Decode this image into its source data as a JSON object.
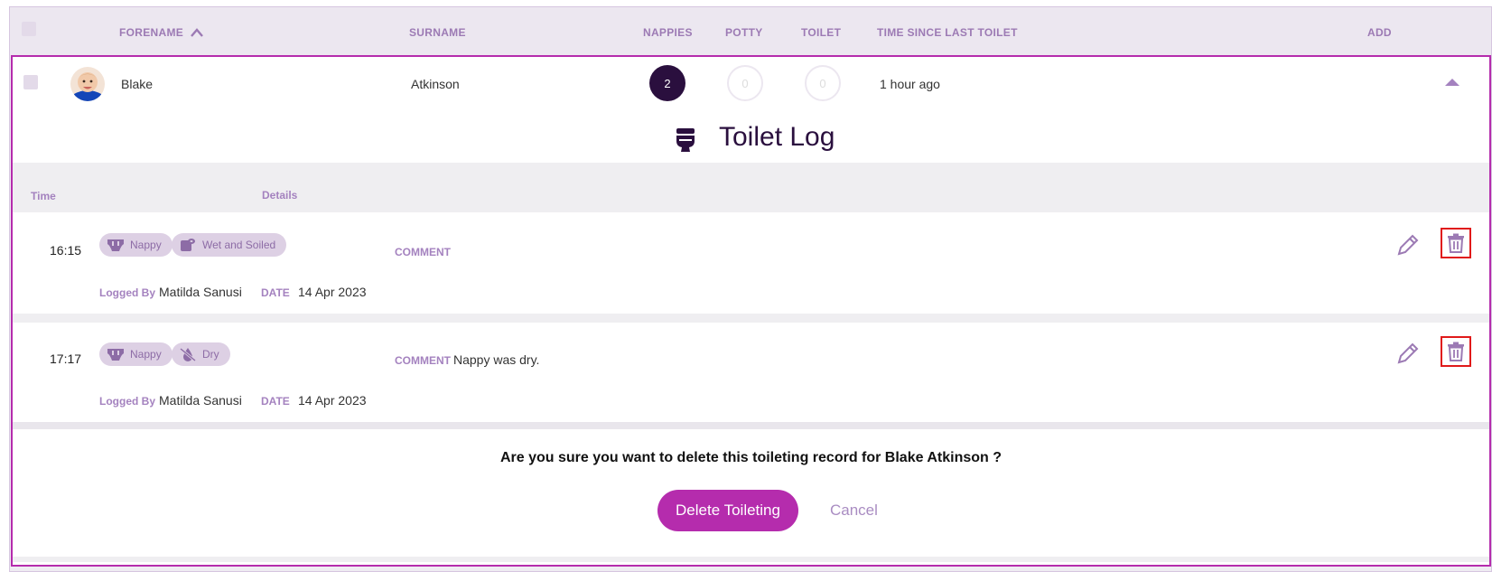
{
  "header": {
    "forename": "FORENAME",
    "surname": "SURNAME",
    "nappies": "NAPPIES",
    "potty": "POTTY",
    "toilet": "TOILET",
    "time_since": "TIME SINCE LAST TOILET",
    "add": "ADD"
  },
  "child": {
    "forename": "Blake",
    "surname": "Atkinson",
    "nappies": "2",
    "potty": "0",
    "toilet": "0",
    "time_since": "1 hour ago"
  },
  "log": {
    "title": "Toilet Log",
    "col_time": "Time",
    "col_details": "Details",
    "comment_label": "COMMENT",
    "logged_by_label": "Logged By",
    "date_label": "DATE",
    "entries": [
      {
        "time": "16:15",
        "tag1": "Nappy",
        "tag1_icon": "nappy-icon",
        "tag2": "Wet and Soiled",
        "tag2_icon": "toilet-roll-icon",
        "comment": "",
        "logged_by": "Matilda Sanusi",
        "date": "14 Apr 2023"
      },
      {
        "time": "17:17",
        "tag1": "Nappy",
        "tag1_icon": "nappy-icon",
        "tag2": "Dry",
        "tag2_icon": "no-water-icon",
        "comment": "Nappy was dry.",
        "logged_by": "Matilda Sanusi",
        "date": "14 Apr 2023"
      }
    ]
  },
  "confirm": {
    "message": "Are you sure you want to delete this toileting record for Blake Atkinson ?",
    "delete_label": "Delete Toileting",
    "cancel_label": "Cancel"
  },
  "colors": {
    "accent": "#b52cad",
    "dark": "#2a0f3e",
    "label": "#a482bf"
  }
}
